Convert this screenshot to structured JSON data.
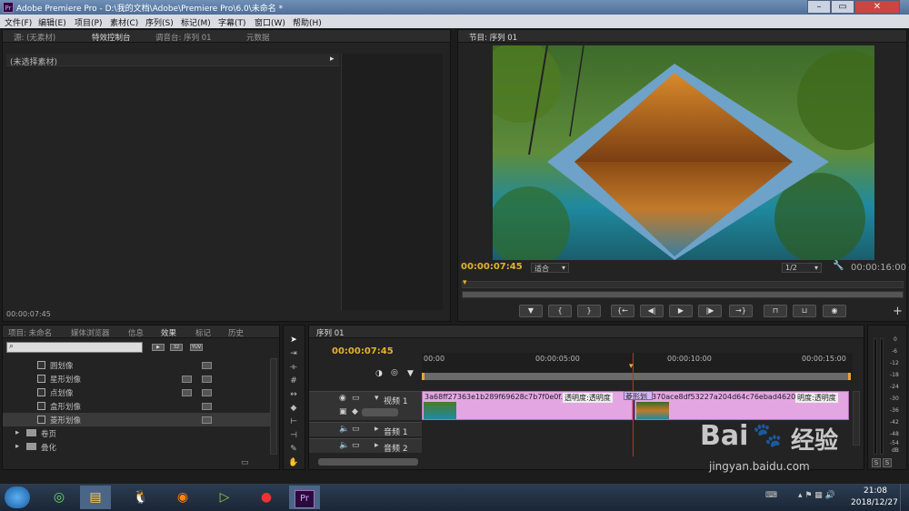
{
  "window": {
    "title": "Adobe Premiere Pro - D:\\我的文档\\Adobe\\Premiere Pro\\6.0\\未命名 *",
    "logo": "Pr"
  },
  "menu": [
    "文件(F)",
    "编辑(E)",
    "项目(P)",
    "素材(C)",
    "序列(S)",
    "标记(M)",
    "字幕(T)",
    "窗口(W)",
    "帮助(H)"
  ],
  "source_panel": {
    "tabs": [
      "源: (无素材)",
      "特效控制台",
      "调音台: 序列 01",
      "元数据"
    ],
    "no_clip": "(未选择素材)",
    "timecode": "00:00:07:45"
  },
  "program": {
    "tab": "节目: 序列 01",
    "timecode": "00:00:07:45",
    "fit": "适合",
    "scale": "1/2",
    "duration": "00:00:16:00"
  },
  "effects_panel": {
    "tabs": [
      "项目: 未命名",
      "媒体浏览器",
      "信息",
      "效果",
      "标记",
      "历史"
    ],
    "items": [
      "圆划像",
      "星形划像",
      "点划像",
      "盒形划像",
      "菱形划像"
    ],
    "folders": [
      "卷页",
      "叠化"
    ]
  },
  "timeline": {
    "tab": "序列 01",
    "timecode": "00:00:07:45",
    "ruler": [
      "00:00",
      "00:00:05:00",
      "00:00:10:00",
      "00:00:15:00"
    ],
    "video_track": "视频 1",
    "audio_tracks": [
      "音频 1",
      "音频 2"
    ],
    "clip1": "3a68ff27363e1b289f69628c7b7f0e0f.jpg",
    "clip1_prop": "透明度:透明度",
    "transition": "菱形划",
    "clip2": "370ace8df53227a204d64c76ebad4620.jpg",
    "clip2_prop": "明度:透明度"
  },
  "audio_meter": {
    "labels": [
      "0",
      "-6",
      "-12",
      "-18",
      "-24",
      "-30",
      "-36",
      "-42",
      "-48",
      "-54",
      "dB"
    ],
    "solo": [
      "S",
      "S"
    ]
  },
  "watermark": {
    "text": "Bai",
    "text2": "经验",
    "url": "jingyan.baidu.com"
  },
  "taskbar": {
    "time": "21:08",
    "date": "2018/12/27",
    "pr": "Pr"
  }
}
